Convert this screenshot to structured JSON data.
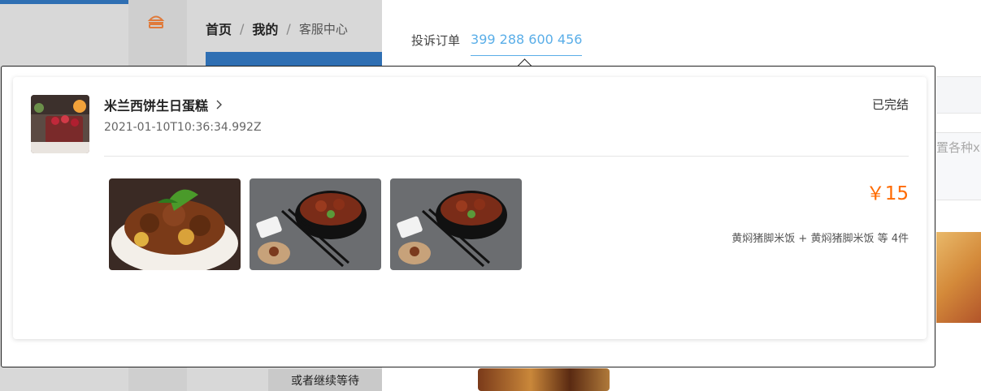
{
  "background": {
    "breadcrumb": {
      "home": "首页",
      "mine": "我的",
      "service": "客服中心",
      "separator": "/"
    },
    "bottom_text": "或者继续等待",
    "input_placeholder_partial": "置各种x"
  },
  "complaint": {
    "label": "投诉订单",
    "order_number": "399 288 600 456"
  },
  "order_card": {
    "shop_name": "米兰西饼生日蛋糕",
    "time": "2021-01-10T10:36:34.992Z",
    "status": "已完结",
    "price": "￥15",
    "items_summary": "黄焖猪脚米饭 + 黄焖猪脚米饭 等 4件",
    "images": [
      "braised-pork-knuckle-photo",
      "pork-trotter-bowl-photo",
      "pork-trotter-bowl-photo"
    ]
  },
  "colors": {
    "accent": "#5aaee8",
    "price": "#ff6a00",
    "brand_blue": "#2f6fb3"
  }
}
